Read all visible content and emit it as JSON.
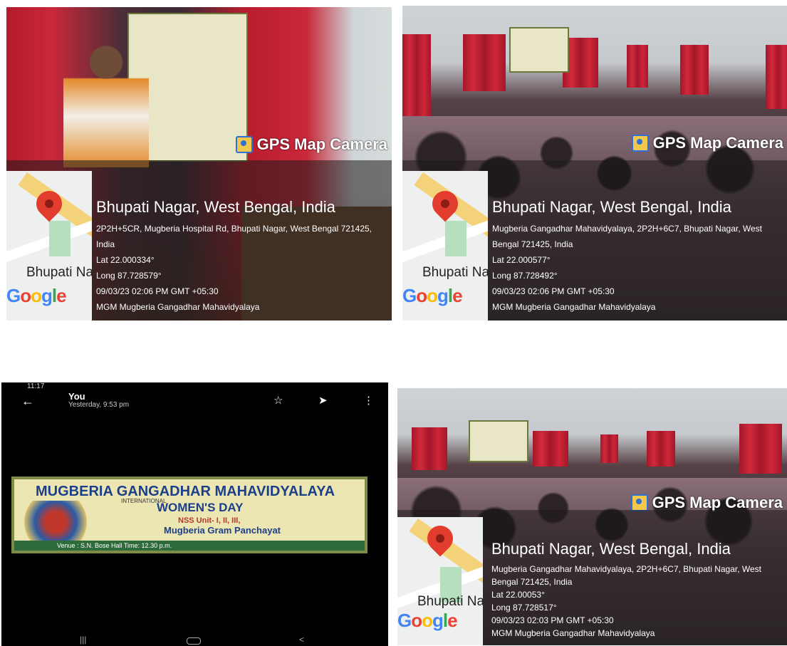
{
  "photos": [
    {
      "gps_label": "GPS Map Camera",
      "map_place": "Bhupati Na",
      "google": "Google",
      "city": "Bhupati Nagar, West Bengal, India",
      "address": "2P2H+5CR, Mugberia Hospital Rd, Bhupati Nagar, West Bengal 721425, India",
      "lat": "Lat 22.000334°",
      "long": "Long 87.728579°",
      "datetime": "09/03/23 02:06 PM GMT +05:30",
      "note": "MGM Mugberia Gangadhar Mahavidyalaya"
    },
    {
      "gps_label": "GPS Map Camera",
      "map_place": "Bhupati Na",
      "google": "Google",
      "city": "Bhupati Nagar, West Bengal, India",
      "address": "Mugberia Gangadhar Mahavidyalaya, 2P2H+6C7, Bhupati Nagar, West Bengal 721425, India",
      "lat": "Lat 22.000577°",
      "long": "Long 87.728492°",
      "datetime": "09/03/23 02:06 PM GMT +05:30",
      "note": "MGM Mugberia Gangadhar Mahavidyalaya"
    },
    {
      "gps_label": "GPS Map Camera",
      "map_place": "Bhupati Na",
      "google": "Google",
      "city": "Bhupati Nagar, West Bengal, India",
      "address": "Mugberia Gangadhar Mahavidyalaya, 2P2H+6C7, Bhupati Nagar, West Bengal 721425, India",
      "lat": "Lat 22.00053°",
      "long": "Long 87.728517°",
      "datetime": "09/03/23 02:03 PM GMT +05:30",
      "note": "MGM Mugberia Gangadhar Mahavidyalaya"
    }
  ],
  "phone": {
    "status_time": "11:17",
    "sender": "You",
    "sent_time": "Yesterday, 9:53 pm",
    "banner": {
      "title": "MUGBERIA GANGADHAR MAHAVIDYALAYA",
      "international": "INTERNATIONAL",
      "womens_day": "WOMEN'S DAY",
      "nss": "NSS Unit- I, II, III,",
      "panchayat": "Mugberia Gram Panchayat",
      "venue": "Venue : S.N. Bose Hall    Time: 12.30 p.m."
    }
  },
  "colors": {
    "pin": "#e23c2e",
    "gps_icon_yellow": "#f1c84b",
    "gps_icon_blue": "#2f6fd6",
    "banner_bg": "#ece6b2",
    "banner_text": "#1d3f8a"
  }
}
